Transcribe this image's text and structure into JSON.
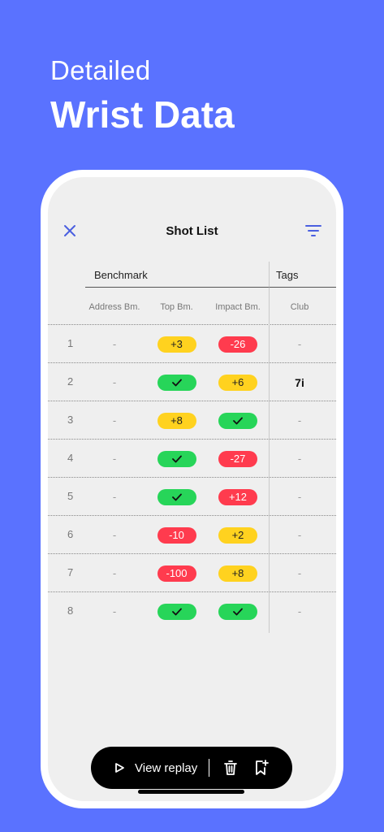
{
  "hero": {
    "subtitle": "Detailed",
    "title": "Wrist Data"
  },
  "screen": {
    "title": "Shot List"
  },
  "table": {
    "groups": {
      "benchmark": "Benchmark",
      "tags": "Tags"
    },
    "columns": {
      "address": "Address Bm.",
      "top": "Top Bm.",
      "impact": "Impact Bm.",
      "club": "Club"
    },
    "rows": [
      {
        "num": "1",
        "address": "-",
        "top": {
          "text": "+3",
          "status": "yellow"
        },
        "impact": {
          "text": "-26",
          "status": "red"
        },
        "club": "-"
      },
      {
        "num": "2",
        "address": "-",
        "top": {
          "text": "",
          "status": "green"
        },
        "impact": {
          "text": "+6",
          "status": "yellow"
        },
        "club": "7i"
      },
      {
        "num": "3",
        "address": "-",
        "top": {
          "text": "+8",
          "status": "yellow"
        },
        "impact": {
          "text": "",
          "status": "green"
        },
        "club": "-"
      },
      {
        "num": "4",
        "address": "-",
        "top": {
          "text": "",
          "status": "green"
        },
        "impact": {
          "text": "-27",
          "status": "red"
        },
        "club": "-"
      },
      {
        "num": "5",
        "address": "-",
        "top": {
          "text": "",
          "status": "green"
        },
        "impact": {
          "text": "+12",
          "status": "red"
        },
        "club": "-"
      },
      {
        "num": "6",
        "address": "-",
        "top": {
          "text": "-10",
          "status": "red"
        },
        "impact": {
          "text": "+2",
          "status": "yellow"
        },
        "club": "-"
      },
      {
        "num": "7",
        "address": "-",
        "top": {
          "text": "-100",
          "status": "red"
        },
        "impact": {
          "text": "+8",
          "status": "yellow"
        },
        "club": "-"
      },
      {
        "num": "8",
        "address": "-",
        "top": {
          "text": "",
          "status": "green"
        },
        "impact": {
          "text": "",
          "status": "green"
        },
        "club": "-"
      }
    ]
  },
  "action_bar": {
    "view_replay_label": "View replay"
  },
  "colors": {
    "background": "#5a72ff",
    "accent": "#4a5fe0",
    "yellow": "#ffd21f",
    "red": "#ff3b4e",
    "green": "#27d559"
  },
  "icons": {
    "close": "close-icon",
    "filter": "filter-icon",
    "check": "check-icon",
    "play": "play-icon",
    "trash": "trash-icon",
    "bookmark": "bookmark-add-icon"
  }
}
